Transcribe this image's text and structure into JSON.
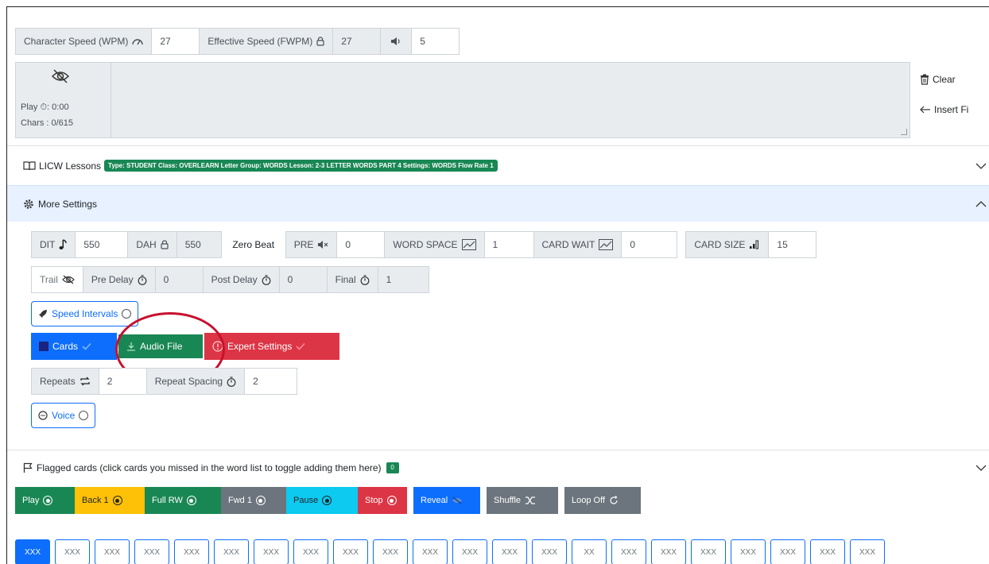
{
  "speed": {
    "char_label": "Character Speed (WPM)",
    "char_value": "27",
    "eff_label": "Effective Speed (FWPM)",
    "eff_value": "27",
    "volume_value": "5"
  },
  "display": {
    "play_time": "Play ⏱: 0:00",
    "chars": "Chars : 0/615"
  },
  "side_actions": {
    "clear_label": "Clear",
    "insert_label": "Insert Fi"
  },
  "lessons": {
    "title": "LICW Lessons",
    "badge": "Type: STUDENT  Class: OVERLEARN  Letter Group: WORDS  Lesson: 2-3 LETTER WORDS PART 4  Settings: WORDS Flow Rate 1"
  },
  "more_settings": {
    "title": "More Settings"
  },
  "dit_row": {
    "dit_label": "DIT",
    "dit_value": "550",
    "dah_label": "DAH",
    "dah_value": "550",
    "zero_beat": "Zero Beat",
    "pre_label": "PRE",
    "pre_value": "0",
    "word_space_label": "WORD SPACE",
    "word_space_value": "1",
    "card_wait_label": "CARD WAIT",
    "card_wait_value": "0",
    "card_size_label": "CARD SIZE",
    "card_size_value": "15"
  },
  "trail_row": {
    "trail_label": "Trail",
    "pre_delay_label": "Pre Delay",
    "pre_delay_value": "0",
    "post_delay_label": "Post Delay",
    "post_delay_value": "0",
    "final_label": "Final",
    "final_value": "1"
  },
  "speed_intervals": {
    "label": "Speed Intervals"
  },
  "buttons": {
    "cards": "Cards",
    "audio_file": "Audio File",
    "expert_settings": "Expert Settings"
  },
  "repeat_row": {
    "repeats_label": "Repeats",
    "repeats_value": "2",
    "spacing_label": "Repeat Spacing",
    "spacing_value": "2"
  },
  "voice": {
    "label": "Voice"
  },
  "flagged": {
    "title": "Flagged cards (click cards you missed in the word list to toggle adding them here)",
    "count": "0"
  },
  "controls": {
    "play": "Play",
    "back": "Back 1",
    "full_rw": "Full RW",
    "fwd": "Fwd 1",
    "pause": "Pause",
    "stop": "Stop",
    "reveal": "Reveal",
    "shuffle": "Shuffle",
    "loop": "Loop Off"
  },
  "cards": [
    "XXX",
    "XXX",
    "XXX",
    "XXX",
    "XXX",
    "XXX",
    "XXX",
    "XXX",
    "XXX",
    "XXX",
    "XXX",
    "XXX",
    "XXX",
    "XXX",
    "XX",
    "XXX",
    "XXX",
    "XXX",
    "XXX",
    "XXX",
    "XXX",
    "XXX"
  ],
  "colors": {
    "primary": "#0d6efd",
    "success": "#198754",
    "danger": "#dc3545",
    "warning": "#ffc107",
    "secondary": "#6c757d",
    "info": "#0dcaf0",
    "highlight_ring": "#c8102e"
  }
}
